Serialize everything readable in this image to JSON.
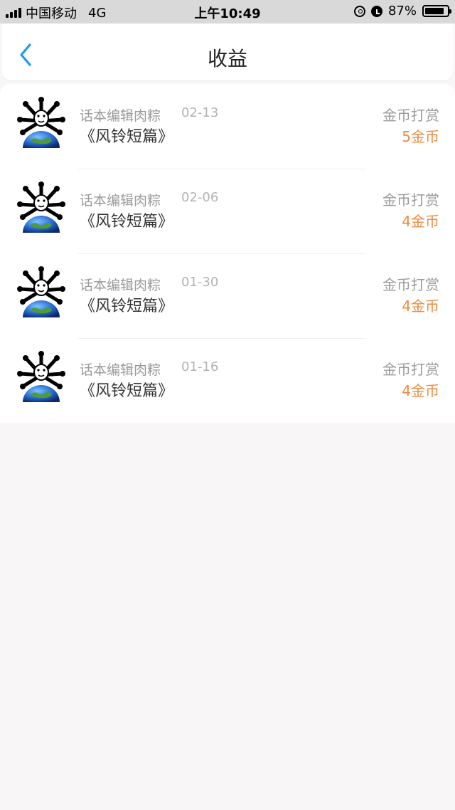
{
  "status_bar": {
    "carrier": "中国移动",
    "network": "4G",
    "time": "上午10:49",
    "battery": "87%",
    "battery_level": 0.87,
    "icons": [
      "signal-icon",
      "rotation-lock-icon",
      "alarm-icon",
      "battery-icon"
    ]
  },
  "nav": {
    "title": "收益",
    "back_icon": "chevron-left-icon",
    "accent": "#2196f3"
  },
  "colors": {
    "reward_amount": "#f08a3e",
    "meta_text": "#9a9a9a"
  },
  "records": [
    {
      "author": "话本编辑肉粽",
      "date": "02-13",
      "title": "《风铃短篇》",
      "reward_type": "金币打赏",
      "amount": "5金币"
    },
    {
      "author": "话本编辑肉粽",
      "date": "02-06",
      "title": "《风铃短篇》",
      "reward_type": "金币打赏",
      "amount": "4金币"
    },
    {
      "author": "话本编辑肉粽",
      "date": "01-30",
      "title": "《风铃短篇》",
      "reward_type": "金币打赏",
      "amount": "4金币"
    },
    {
      "author": "话本编辑肉粽",
      "date": "01-16",
      "title": "《风铃短篇》",
      "reward_type": "金币打赏",
      "amount": "4金币"
    }
  ]
}
